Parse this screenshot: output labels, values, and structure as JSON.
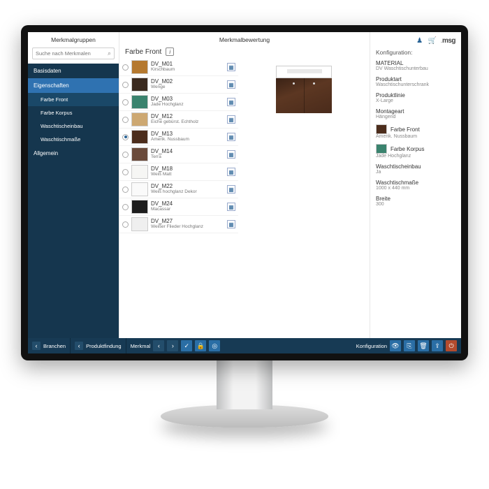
{
  "sidebar": {
    "title": "Merkmalgruppen",
    "search_placeholder": "Suche nach Merkmalen",
    "items": [
      "Basisdaten",
      "Eigenschaften"
    ],
    "subs": [
      "Farbe Front",
      "Farbe Korpus",
      "Waschtischeinbau",
      "Waschtischmaße"
    ],
    "footer": "Allgemein"
  },
  "center": {
    "title": "Merkmalbewertung",
    "subtitle": "Farbe Front"
  },
  "options": [
    {
      "code": "DV_M01",
      "name": "Kirschbaum",
      "color": "#b5792f",
      "sel": false
    },
    {
      "code": "DV_M02",
      "name": "Wenge",
      "color": "#3b2a1f",
      "sel": false
    },
    {
      "code": "DV_M03",
      "name": "Jade Hochglanz",
      "color": "#3a836e",
      "sel": false
    },
    {
      "code": "DV_M12",
      "name": "Eiche gebürst. Echtholz",
      "color": "#cda872",
      "sel": false
    },
    {
      "code": "DV_M13",
      "name": "Amerik. Nussbaum",
      "color": "#4c2d1c",
      "sel": true
    },
    {
      "code": "DV_M14",
      "name": "Terra",
      "color": "#6b4b3b",
      "sel": false
    },
    {
      "code": "DV_M18",
      "name": "Weiß Matt",
      "color": "#f6f6f4",
      "sel": false
    },
    {
      "code": "DV_M22",
      "name": "Weiß hochglanz Dekor",
      "color": "#fafafa",
      "sel": false
    },
    {
      "code": "DV_M24",
      "name": "Macassar",
      "color": "#1d1d1d",
      "sel": false
    },
    {
      "code": "DV_M27",
      "name": "Weißer Flieder Hochglanz",
      "color": "#efefef",
      "sel": false
    }
  ],
  "config": {
    "title": "Konfiguration:",
    "logo": "msg",
    "fields": {
      "material_l": "MATERIAL",
      "material_v": "DV Waschtischunterbau",
      "art_l": "Produktart",
      "art_v": "Waschtischunterschrank",
      "line_l": "Produktlinie",
      "line_v": "X-Large",
      "mount_l": "Montageart",
      "mount_v": "Hängend",
      "front_l": "Farbe Front",
      "front_v": "Amerik. Nussbaum",
      "front_c": "#4c2d1c",
      "korp_l": "Farbe Korpus",
      "korp_v": "Jade Hochglanz",
      "korp_c": "#3a836e",
      "wt_l": "Waschtischeinbau",
      "wt_v": "Ja",
      "wtm_l": "Waschtischmaße",
      "wtm_v": "1000 x 440 mm",
      "breite_l": "Breite",
      "breite_v": "300"
    }
  },
  "footer": {
    "branchen": "Branchen",
    "produkt": "Produktfindung",
    "merkmal": "Merkmal",
    "konfig": "Konfiguration"
  }
}
